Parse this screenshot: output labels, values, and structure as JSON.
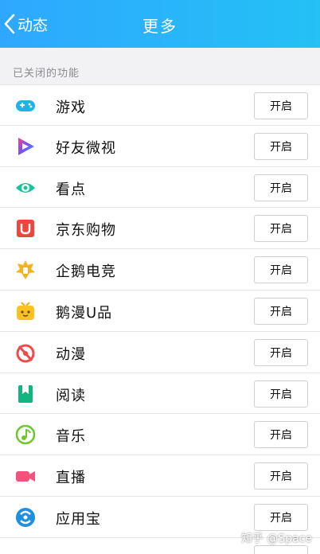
{
  "header": {
    "back_label": "动态",
    "title": "更多"
  },
  "section": {
    "label": "已关闭的功能"
  },
  "items": [
    {
      "label": "游戏",
      "button": "开启",
      "icon": "gamepad-icon"
    },
    {
      "label": "好友微视",
      "button": "开启",
      "icon": "weishi-icon"
    },
    {
      "label": "看点",
      "button": "开启",
      "icon": "eye-icon"
    },
    {
      "label": "京东购物",
      "button": "开启",
      "icon": "jd-shopping-icon"
    },
    {
      "label": "企鹅电竞",
      "button": "开启",
      "icon": "esports-icon"
    },
    {
      "label": "鹅漫U品",
      "button": "开启",
      "icon": "tv-box-icon"
    },
    {
      "label": "动漫",
      "button": "开启",
      "icon": "comic-icon"
    },
    {
      "label": "阅读",
      "button": "开启",
      "icon": "book-icon"
    },
    {
      "label": "音乐",
      "button": "开启",
      "icon": "music-icon"
    },
    {
      "label": "直播",
      "button": "开启",
      "icon": "camera-icon"
    },
    {
      "label": "应用宝",
      "button": "开启",
      "icon": "app-store-icon"
    },
    {
      "label": "",
      "button": "",
      "icon": "partial-icon"
    }
  ],
  "watermark": "知乎 @Space"
}
